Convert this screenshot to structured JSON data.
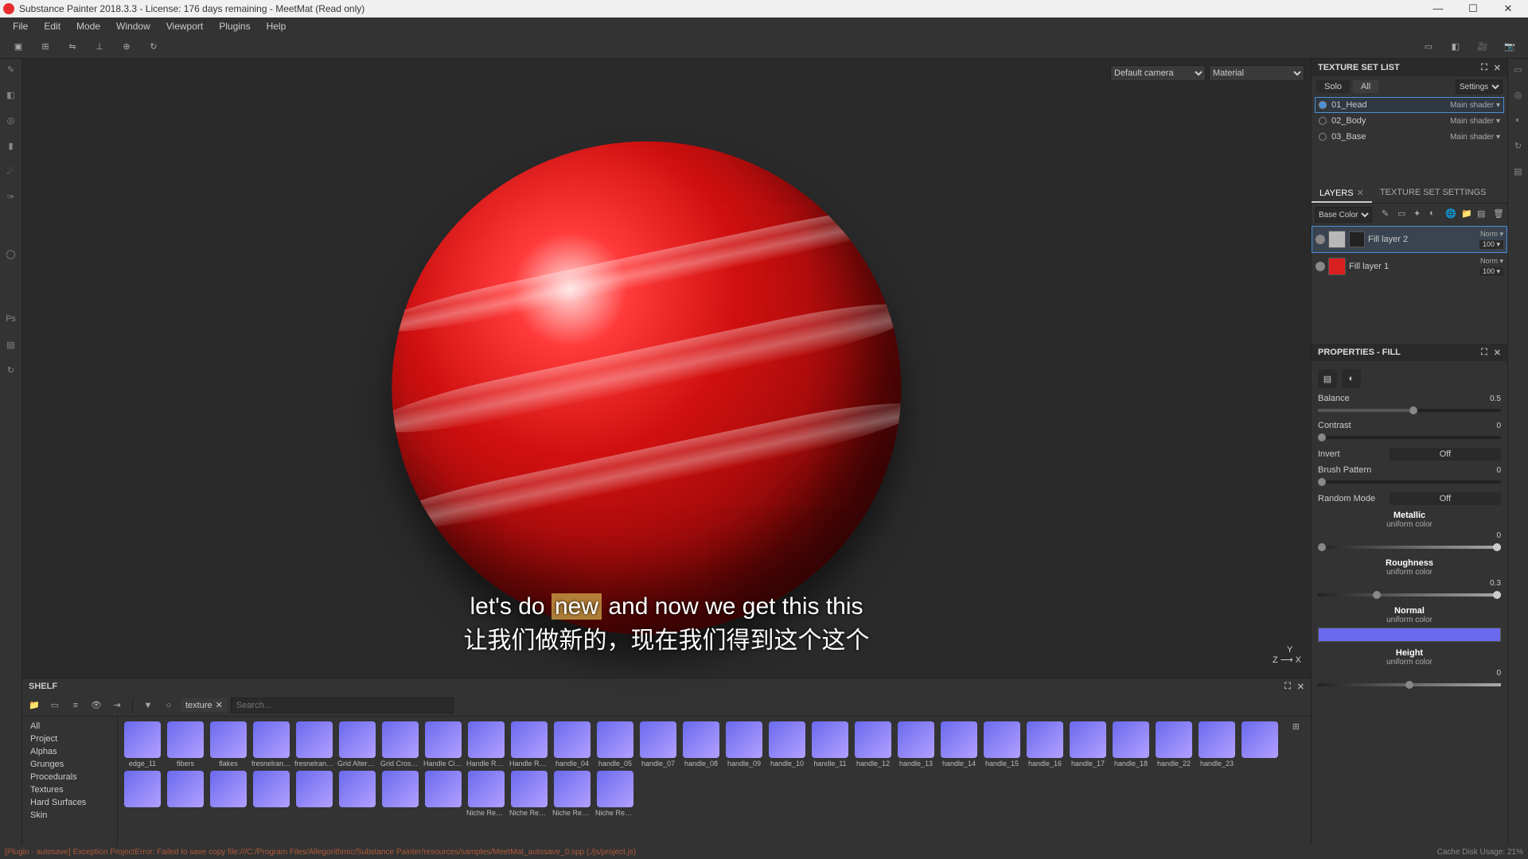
{
  "titlebar": {
    "text": "Substance Painter 2018.3.3 - License: 176 days remaining - MeetMat (Read only)"
  },
  "menu": {
    "items": [
      "File",
      "Edit",
      "Mode",
      "Window",
      "Viewport",
      "Plugins",
      "Help"
    ]
  },
  "viewport": {
    "camera_select": "Default camera",
    "channel_select": "Material",
    "axis": {
      "y": "Y",
      "z": "Z",
      "x": "X"
    }
  },
  "subtitle": {
    "en_pre": "let's do ",
    "en_hl": "new",
    "en_post": " and now we get this this",
    "cn": "让我们做新的，现在我们得到这个这个"
  },
  "texset": {
    "title": "TEXTURE SET LIST",
    "solo": "Solo",
    "all": "All",
    "settings": "Settings",
    "rows": [
      {
        "name": "01_Head",
        "shader": "Main shader",
        "active": true
      },
      {
        "name": "02_Body",
        "shader": "Main shader",
        "active": false
      },
      {
        "name": "03_Base",
        "shader": "Main shader",
        "active": false
      }
    ]
  },
  "layers": {
    "tab_layers": "LAYERS",
    "tab_tss": "TEXTURE SET SETTINGS",
    "channel_select": "Base Color",
    "rows": [
      {
        "name": "Fill layer 2",
        "blend": "Norm",
        "opacity": "100",
        "active": true,
        "swatch": "#b8b8b8",
        "mask": true
      },
      {
        "name": "Fill layer 1",
        "blend": "Norm",
        "opacity": "100",
        "active": false,
        "swatch": "#d82020",
        "mask": false
      }
    ]
  },
  "properties": {
    "title": "PROPERTIES - FILL",
    "balance_label": "Balance",
    "balance_val": "0.5",
    "contrast_label": "Contrast",
    "contrast_val": "0",
    "invert_label": "Invert",
    "invert_val": "Off",
    "brush_label": "Brush Pattern",
    "brush_val": "0",
    "random_label": "Random Mode",
    "random_val": "Off",
    "metallic": "Metallic",
    "uniform": "uniform color",
    "metallic_val": "0",
    "roughness": "Roughness",
    "roughness_val": "0.3",
    "normal": "Normal",
    "height": "Height",
    "height_val": "0",
    "normal_color": "#6a6aee"
  },
  "shelf": {
    "title": "SHELF",
    "tag": "texture",
    "search_placeholder": "Search...",
    "categories": [
      "All",
      "Project",
      "Alphas",
      "Grunges",
      "Procedurals",
      "Textures",
      "Hard Surfaces",
      "Skin"
    ],
    "items_row1": [
      "edge_11",
      "fibers",
      "flakes",
      "fresnelranges",
      "fresnelrang...",
      "Grid Alternate",
      "Grid Crossed",
      "Handle Circle",
      "Handle Rec...",
      "Handle Rec...",
      "handle_04",
      "handle_05",
      "handle_07",
      "handle_08",
      "handle_09",
      "handle_10",
      "handle_11",
      "handle_12",
      "handle_13"
    ],
    "items_row2": [
      "handle_14",
      "handle_15",
      "handle_16",
      "handle_17",
      "handle_18",
      "handle_22",
      "handle_23",
      "",
      "",
      "",
      "",
      "",
      "",
      "",
      "",
      "",
      "Niche Recta...",
      "Niche Recta...",
      "Niche Recta...",
      "Niche Recta..."
    ]
  },
  "statusbar": {
    "error": "[Plugin - autosave] Exception ProjectError: Failed to save copy file:///C:/Program Files/Allegorithmic/Substance Painter/resources/samples/MeetMat_autosave_0.spp (:/js/project.js)",
    "cache": "Cache Disk Usage:   21%"
  }
}
